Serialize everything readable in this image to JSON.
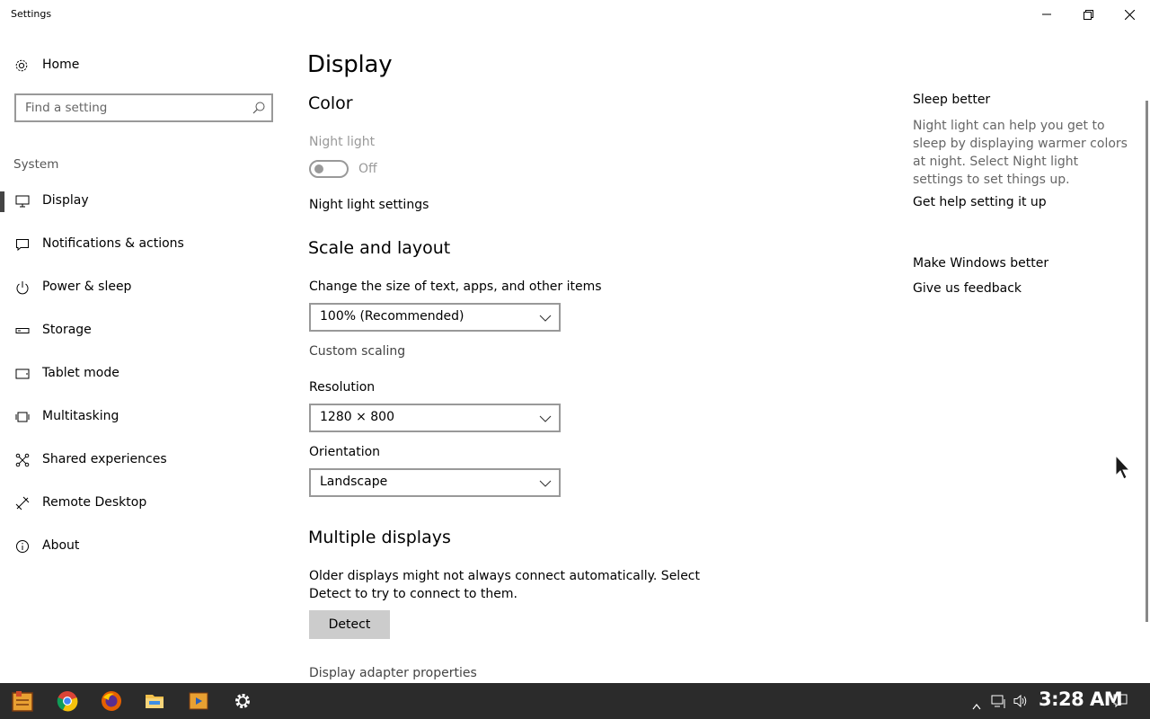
{
  "window": {
    "title": "Settings",
    "minimize_icon": "minimize-icon",
    "maximize_icon": "restore-icon",
    "close_icon": "close-icon"
  },
  "sidebar": {
    "home_label": "Home",
    "search_placeholder": "Find a setting",
    "group_label": "System",
    "items": [
      {
        "label": "Display",
        "icon": "monitor-icon",
        "active": true
      },
      {
        "label": "Notifications & actions",
        "icon": "message-icon"
      },
      {
        "label": "Power & sleep",
        "icon": "power-icon"
      },
      {
        "label": "Storage",
        "icon": "storage-icon"
      },
      {
        "label": "Tablet mode",
        "icon": "tablet-icon"
      },
      {
        "label": "Multitasking",
        "icon": "multitasking-icon"
      },
      {
        "label": "Shared experiences",
        "icon": "shared-icon"
      },
      {
        "label": "Remote Desktop",
        "icon": "remote-desktop-icon"
      },
      {
        "label": "About",
        "icon": "info-icon"
      }
    ]
  },
  "main": {
    "title": "Display",
    "color_heading": "Color",
    "night_light_label": "Night light",
    "night_light_state": "Off",
    "night_light_settings": "Night light settings",
    "scale_heading": "Scale and layout",
    "scale_label": "Change the size of text, apps, and other items",
    "scale_value": "100% (Recommended)",
    "custom_scaling": "Custom scaling",
    "resolution_label": "Resolution",
    "resolution_value": "1280 × 800",
    "orientation_label": "Orientation",
    "orientation_value": "Landscape",
    "multi_heading": "Multiple displays",
    "multi_text_line1": "Older displays might not always connect automatically. Select",
    "multi_text_line2": "Detect to try to connect to them.",
    "detect_label": "Detect",
    "adapter_link": "Display adapter properties"
  },
  "aside": {
    "sleep_heading": "Sleep better",
    "sleep_text": "Night light can help you get to sleep by displaying warmer colors at night. Select Night light settings to set things up.",
    "help_link": "Get help setting it up",
    "better_heading": "Make Windows better",
    "feedback_link": "Give us feedback"
  },
  "taskbar": {
    "apps": [
      "start-icon",
      "chrome-icon",
      "firefox-icon",
      "file-explorer-icon",
      "media-player-icon",
      "settings-icon"
    ],
    "clock": "3:28 AM"
  }
}
